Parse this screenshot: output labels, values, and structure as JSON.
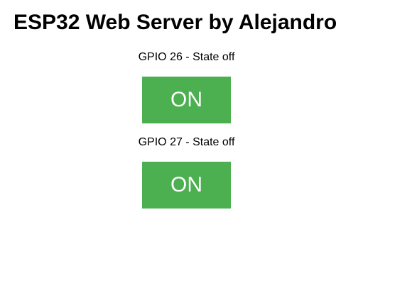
{
  "header": {
    "title": "ESP32 Web Server by Alejandro"
  },
  "outputs": [
    {
      "label": "GPIO 26 - State off",
      "button_label": "ON"
    },
    {
      "label": "GPIO 27 - State off",
      "button_label": "ON"
    }
  ],
  "colors": {
    "button_bg": "#4CAF50",
    "button_text": "#FFFFFF"
  }
}
